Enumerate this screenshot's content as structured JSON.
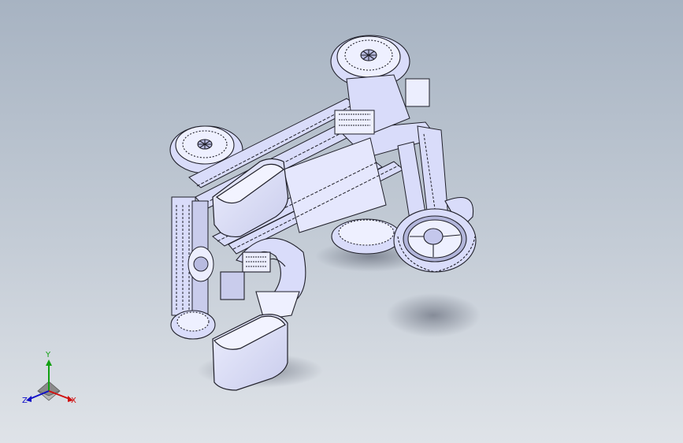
{
  "viewport": {
    "background_top": "#a7b3c2",
    "background_bottom": "#dfe3e8",
    "model_color": "#d9dcfa",
    "model_edge_color": "#20202a",
    "shadow_color": "#4a5060"
  },
  "triad": {
    "x_label": "X",
    "y_label": "Y",
    "z_label": "Z",
    "x_color": "#d01010",
    "y_color": "#10a010",
    "z_color": "#1010c8"
  }
}
